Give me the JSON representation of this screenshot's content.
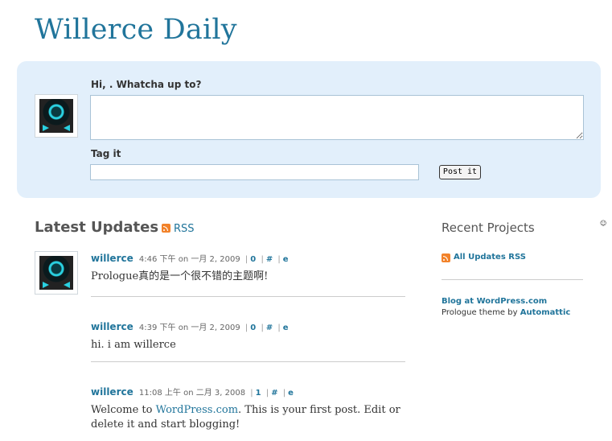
{
  "site": {
    "title": "Willerce Daily"
  },
  "postbox": {
    "prompt": "Hi, . Whatcha up to?",
    "post_value": "",
    "tag_label": "Tag it",
    "tag_value": "",
    "submit_label": "Post it"
  },
  "updates": {
    "heading": "Latest Updates",
    "rss_label": "RSS",
    "posts": [
      {
        "author": "willerce",
        "time": "4:46 下午 on 一月 2, 2009",
        "comments": "0",
        "permalink": "#",
        "edit": "e",
        "text": "Prologue真的是一个很不错的主题啊!"
      },
      {
        "author": "willerce",
        "time": "4:39 下午 on 一月 2, 2009",
        "comments": "0",
        "permalink": "#",
        "edit": "e",
        "text": "hi. i am willerce"
      },
      {
        "author": "willerce",
        "time": "11:08 上午 on 二月 3, 2008",
        "comments": "1",
        "permalink": "#",
        "edit": "e",
        "text_before": "Welcome to ",
        "text_link": "WordPress.com",
        "text_after": ". This is your first post. Edit or delete it and start blogging!"
      }
    ]
  },
  "sidebar": {
    "heading": "Recent Projects",
    "smiley": "☺",
    "all_updates_label": "All Updates RSS",
    "blog_at_label": "Blog at WordPress.com",
    "theme_prefix": "Prologue theme by ",
    "theme_author": "Automattic"
  },
  "colors": {
    "accent": "#21759b",
    "postbox_bg": "#e2effb",
    "rss": "#f2822a"
  },
  "icons": [
    "rss-icon",
    "avatar"
  ]
}
